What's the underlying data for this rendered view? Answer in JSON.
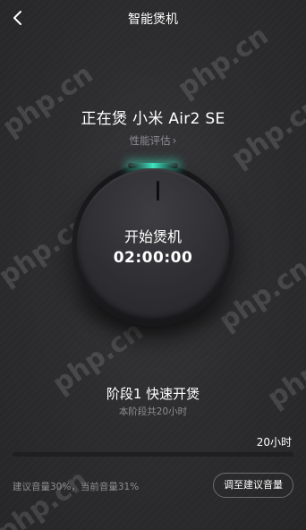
{
  "header": {
    "title": "智能煲机",
    "back_icon": "chevron-left-icon"
  },
  "status": {
    "title": "正在煲 小米 Air2 SE",
    "perf_link_label": "性能评估",
    "perf_link_icon": "chevron-right-icon"
  },
  "dial": {
    "label": "开始煲机",
    "time": "02:00:00",
    "glow_color": "#3ee3c0"
  },
  "stage": {
    "title": "阶段1 快速开煲",
    "subtitle": "本阶段共20小时"
  },
  "progress": {
    "duration_label": "20小时",
    "fraction": 0.0
  },
  "volume": {
    "text": "建议音量30%，当前音量31%",
    "adjust_button": "调至建议音量"
  },
  "watermark": {
    "text": "php.cn"
  },
  "colors": {
    "background": "#2d2d2f",
    "accent": "#3ee3c0",
    "muted_text": "#8e8e92"
  }
}
